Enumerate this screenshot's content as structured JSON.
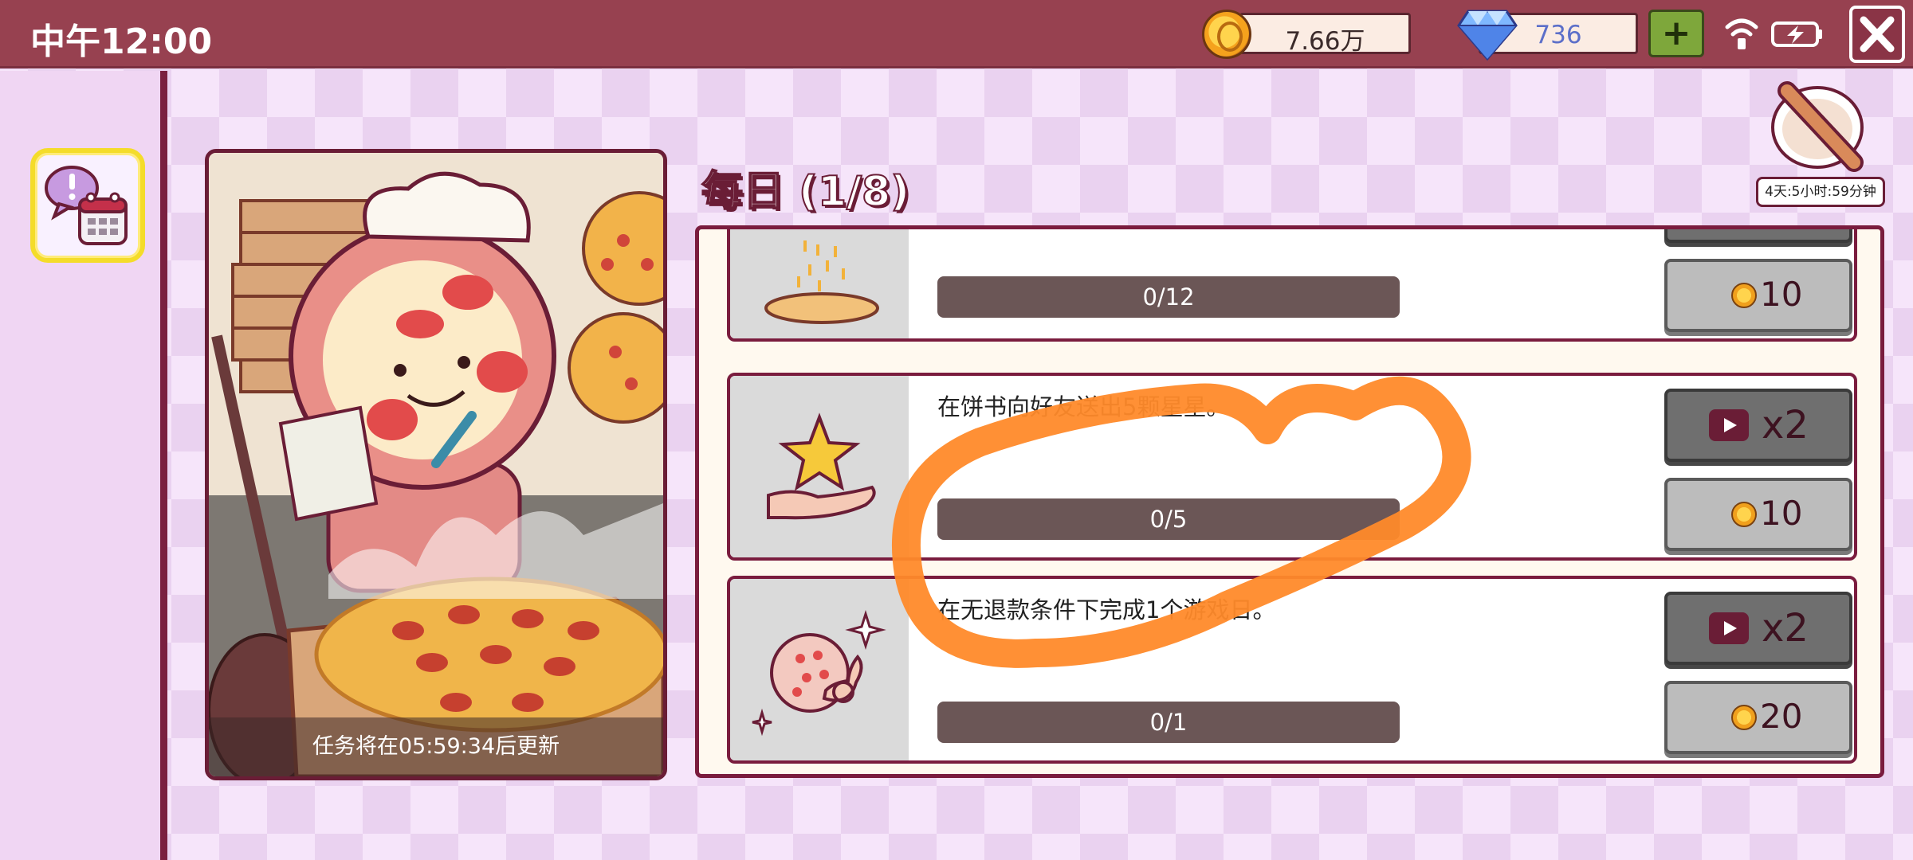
{
  "status_bar": {
    "time": "中午12:00"
  },
  "currency": {
    "coins": "7.66万",
    "gems": "736",
    "add_button": "+"
  },
  "illustration": {
    "refresh_caption": "任务将在05:59:34后更新"
  },
  "section": {
    "title": "每日 (1/8)"
  },
  "event_timer": {
    "label": "4天:5小时:59分钟"
  },
  "tasks": [
    {
      "description": "",
      "progress": "0/12",
      "progress_fraction": 0,
      "reward_coins": "10",
      "icon": "pizza-cheese-icon"
    },
    {
      "description": "在饼书向好友送出5颗星星。",
      "progress": "0/5",
      "progress_fraction": 0,
      "video_bonus": "x2",
      "reward_coins": "10",
      "icon": "star-hand-icon"
    },
    {
      "description": "在无退款条件下完成1个游戏日。",
      "progress": "0/1",
      "progress_fraction": 0,
      "video_bonus": "x2",
      "reward_coins": "20",
      "icon": "pizza-ok-icon"
    }
  ],
  "colors": {
    "topbar": "#974150",
    "accent_border": "#7a1c3e",
    "annotation_stroke": "#ff8a2a"
  }
}
